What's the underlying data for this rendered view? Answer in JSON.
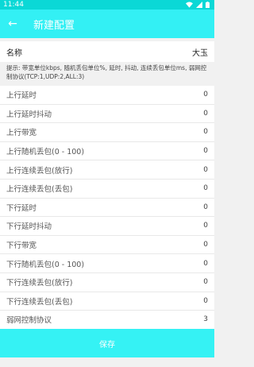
{
  "status_bar": {
    "time": "11:44"
  },
  "app_bar": {
    "title": "新建配置"
  },
  "name_field": {
    "label": "名称",
    "value": "大玉"
  },
  "hint": "提示: 带宽单位kbps, 随机丢包单位%, 延时, 抖动, 连续丢包单位ms, 弱网控制协议(TCP:1,UDP:2,ALL:3)",
  "rows": [
    {
      "label": "上行延时",
      "value": "0"
    },
    {
      "label": "上行延时抖动",
      "value": "0"
    },
    {
      "label": "上行带宽",
      "value": "0"
    },
    {
      "label": "上行随机丢包(0 - 100)",
      "value": "0"
    },
    {
      "label": "上行连续丢包(放行)",
      "value": "0"
    },
    {
      "label": "上行连续丢包(丢包)",
      "value": "0"
    },
    {
      "label": "下行延时",
      "value": "0"
    },
    {
      "label": "下行延时抖动",
      "value": "0"
    },
    {
      "label": "下行带宽",
      "value": "0"
    },
    {
      "label": "下行随机丢包(0 - 100)",
      "value": "0"
    },
    {
      "label": "下行连续丢包(放行)",
      "value": "0"
    },
    {
      "label": "下行连续丢包(丢包)",
      "value": "0"
    },
    {
      "label": "弱网控制协议",
      "value": "3"
    }
  ],
  "save_button": {
    "label": "保存"
  },
  "colors": {
    "accent": "#33f0f4",
    "status_bar": "#0bd8d6"
  }
}
